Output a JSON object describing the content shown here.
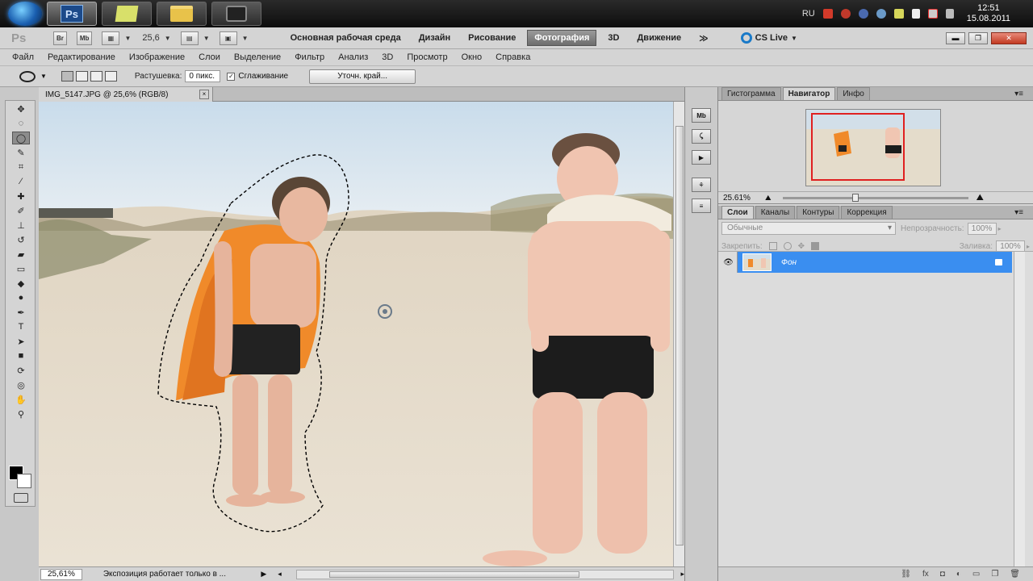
{
  "taskbar": {
    "lang": "RU",
    "clock_time": "12:51",
    "clock_date": "15.08.2011",
    "ps_label": "Ps"
  },
  "appbar": {
    "logo": "Ps",
    "br_label": "Br",
    "mb_label": "Mb",
    "zoom": "25,6",
    "workspaces": [
      "Основная рабочая среда",
      "Дизайн",
      "Рисование",
      "Фотография",
      "3D",
      "Движение"
    ],
    "active_workspace_index": 3,
    "more": "≫",
    "cs_live": "CS Live"
  },
  "menu": [
    "Файл",
    "Редактирование",
    "Изображение",
    "Слои",
    "Выделение",
    "Фильтр",
    "Анализ",
    "3D",
    "Просмотр",
    "Окно",
    "Справка"
  ],
  "options": {
    "feather_label": "Растушевка:",
    "feather_value": "0 пикс.",
    "antialias_label": "Сглаживание",
    "antialias_checked": true,
    "refine_edge": "Уточн. край..."
  },
  "document": {
    "tab_title": "IMG_5147.JPG @ 25,6% (RGB/8)",
    "close": "×"
  },
  "status": {
    "zoom": "25,61%",
    "message": "Экспозиция работает только в ..."
  },
  "navigator": {
    "tabs": [
      "Гистограмма",
      "Навигатор",
      "Инфо"
    ],
    "active_tab_index": 1,
    "zoom": "25.61%"
  },
  "layers": {
    "tabs": [
      "Слои",
      "Каналы",
      "Контуры",
      "Коррекция"
    ],
    "active_tab_index": 0,
    "blend_mode": "Обычные",
    "opacity_label": "Непрозрачность:",
    "opacity_value": "100%",
    "lock_label": "Закрепить:",
    "fill_label": "Заливка:",
    "fill_value": "100%",
    "items": [
      {
        "name": "Фон",
        "visible": true,
        "locked": true,
        "selected": true
      }
    ]
  },
  "colors": {
    "accent_selected_layer": "#3a8ef0",
    "navigator_box": "#e02020",
    "foreground": "#000000",
    "background": "#ffffff"
  }
}
